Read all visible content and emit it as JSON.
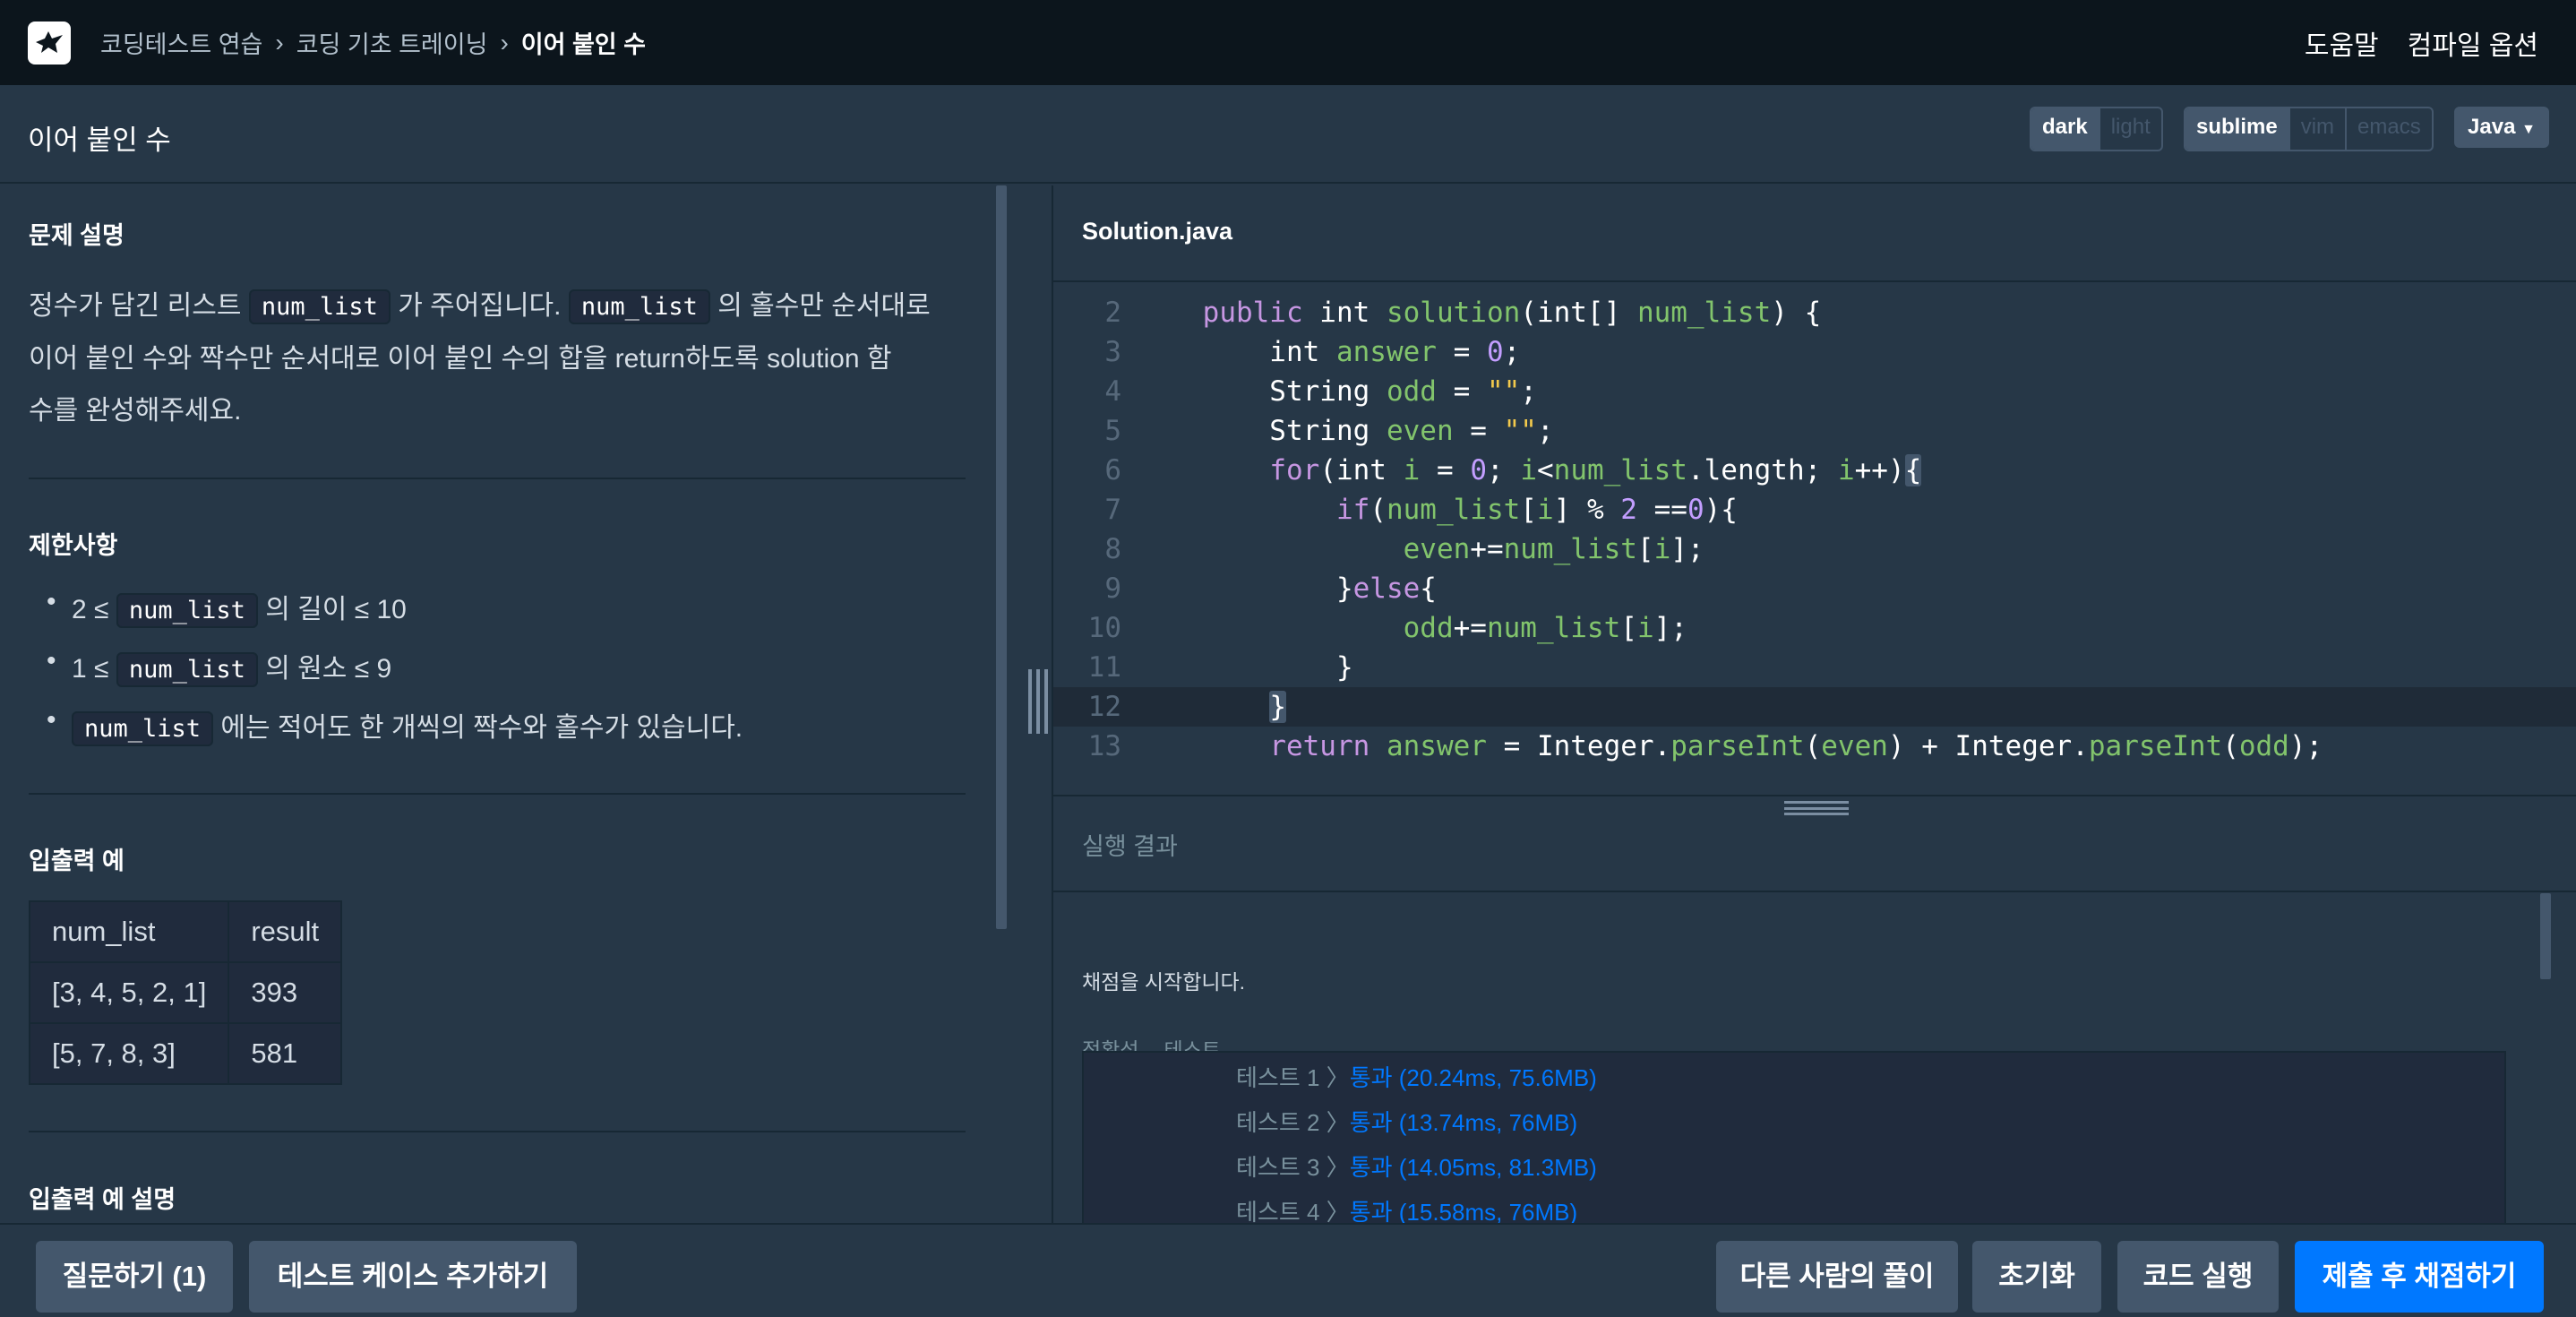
{
  "header": {
    "breadcrumbs": [
      "코딩테스트 연습",
      "코딩 기초 트레이닝",
      "이어 붙인 수"
    ],
    "help": "도움말",
    "compile_options": "컴파일 옵션"
  },
  "titlebar": {
    "title": "이어 붙인 수",
    "theme": {
      "dark": "dark",
      "light": "light",
      "selected": "dark"
    },
    "keymap": {
      "sublime": "sublime",
      "vim": "vim",
      "emacs": "emacs",
      "selected": "sublime"
    },
    "language": "Java"
  },
  "problem": {
    "desc_heading": "문제 설명",
    "desc": {
      "a": "정수가 담긴 리스트",
      "code1": "num_list",
      "b": "가 주어집니다.",
      "code2": "num_list",
      "c": "의 홀수만 순서대로",
      "line2": "이어 붙인 수와 짝수만 순서대로 이어 붙인 수의 합을 return하도록 solution 함",
      "line3": "수를 완성해주세요."
    },
    "constraints_heading": "제한사항",
    "constraints": [
      {
        "pre": "2 ≤",
        "code": "num_list",
        "post": "의 길이 ≤ 10"
      },
      {
        "pre": "1 ≤",
        "code": "num_list",
        "post": "의 원소 ≤ 9"
      },
      {
        "pre": "",
        "code": "num_list",
        "post": "에는 적어도 한 개씩의 짝수와 홀수가 있습니다."
      }
    ],
    "io_heading": "입출력 예",
    "io_table": {
      "headers": [
        "num_list",
        "result"
      ],
      "rows": [
        [
          "[3, 4, 5, 2, 1]",
          "393"
        ],
        [
          "[5, 7, 8, 3]",
          "581"
        ]
      ]
    },
    "io_explain_heading": "입출력 예 설명"
  },
  "editor": {
    "filename": "Solution.java",
    "line_numbers": [
      "2",
      "3",
      "4",
      "5",
      "6",
      "7",
      "8",
      "9",
      "10",
      "11",
      "12",
      "13"
    ]
  },
  "results": {
    "title": "실행 결과",
    "start_msg": "채점을 시작합니다.",
    "category": "정확성",
    "category2": "테스트",
    "tests": [
      {
        "label": "테스트 1",
        "result": "통과 (20.24ms, 75.6MB)"
      },
      {
        "label": "테스트 2",
        "result": "통과 (13.74ms, 76MB)"
      },
      {
        "label": "테스트 3",
        "result": "통과 (14.05ms, 81.3MB)"
      },
      {
        "label": "테스트 4",
        "result": "통과 (15.58ms, 76MB)"
      }
    ]
  },
  "footer": {
    "ask": "질문하기 (1)",
    "add_test": "테스트 케이스 추가하기",
    "others": "다른 사람의 풀이",
    "reset": "초기화",
    "run": "코드 실행",
    "submit": "제출 후 채점하기",
    "submit_color": "#0078ff"
  }
}
